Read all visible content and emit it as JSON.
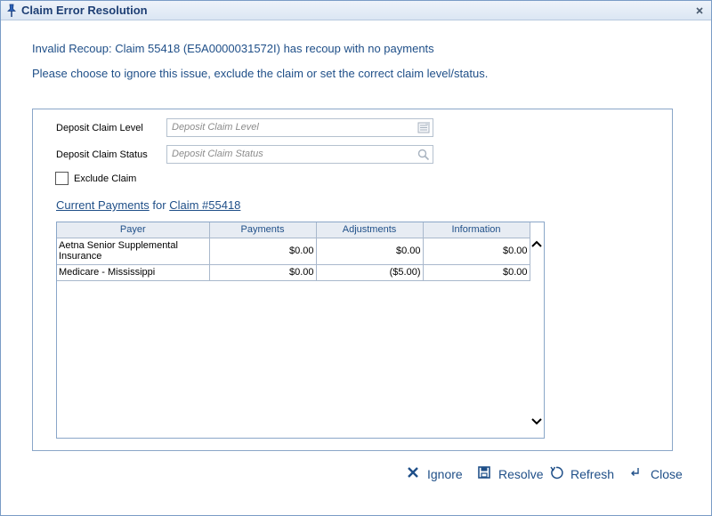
{
  "window": {
    "title": "Claim Error Resolution",
    "icons": {
      "pin": "pin-icon",
      "close": "close-icon"
    }
  },
  "messages": {
    "error": "Invalid Recoup: Claim 55418 (E5A0000031572I) has recoup with no payments",
    "instruction": "Please choose to ignore this issue, exclude the claim or set the correct claim level/status."
  },
  "form": {
    "level_label": "Deposit Claim Level",
    "level_placeholder": "Deposit Claim Level",
    "status_label": "Deposit Claim Status",
    "status_placeholder": "Deposit Claim Status",
    "exclude_label": "Exclude Claim",
    "exclude_checked": false
  },
  "payments": {
    "link_current": "Current Payments",
    "for_text": "for",
    "link_claim": "Claim #55418",
    "columns": [
      "Payer",
      "Payments",
      "Adjustments",
      "Information"
    ],
    "rows": [
      {
        "payer": "Aetna Senior Supplemental Insurance",
        "payments": "$0.00",
        "adjustments": "$0.00",
        "information": "$0.00"
      },
      {
        "payer": "Medicare - Mississippi",
        "payments": "$0.00",
        "adjustments": "($5.00)",
        "information": "$0.00"
      }
    ]
  },
  "actions": {
    "ignore": "Ignore",
    "resolve": "Resolve",
    "refresh": "Refresh",
    "close": "Close"
  },
  "colors": {
    "title_text": "#1e3f74",
    "link_text": "#1f4f88",
    "border": "#8aa6c8",
    "header_bg": "#e7ecf3"
  }
}
